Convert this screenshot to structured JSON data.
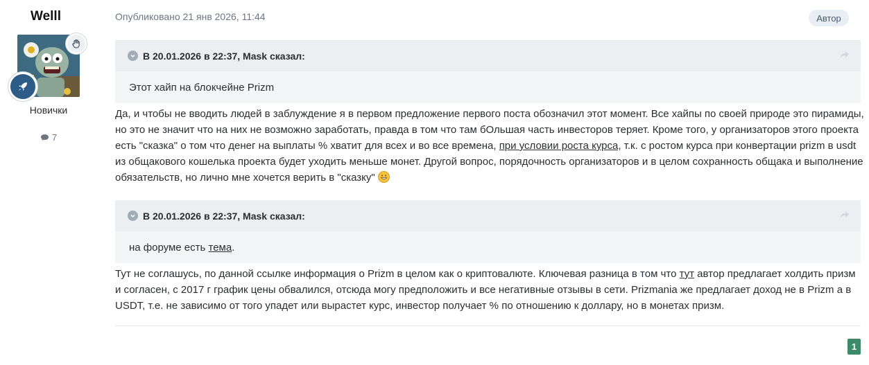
{
  "author": {
    "username": "Welll",
    "rank": "Новички",
    "post_count": "7",
    "avatar_icon": "zombie-cartoon-avatar",
    "badge_icons": [
      "raised-hand-icon",
      "rocket-icon"
    ]
  },
  "post": {
    "published": "Опубликовано 21 янв 2026, 11:44",
    "author_tag": "Автор",
    "quotes": [
      {
        "header": "В 20.01.2026 в 22:37, Mask сказал:",
        "body": "Этот хайп на блокчейне Prizm"
      },
      {
        "header": "В 20.01.2026 в 22:37, Mask сказал:",
        "body_prefix": "на форуме есть ",
        "body_link": "тема",
        "body_suffix": "."
      }
    ],
    "paragraph1": {
      "text_a": "Да, и чтобы не вводить людей в заблуждение я в первом предложение первого поста обозначил этот момент. Все хайпы по своей природе это пирамиды, но это не значит что на них не возможно заработать, правда в том что там бОльшая часть инвесторов теряет. Кроме того, у организаторов этого проекта есть \"сказка\" о том что денег на выплаты % хватит для всех и во все времена, ",
      "link": "при условии роста курса,",
      "text_b": " т.к. с ростом курса при конвертации prizm в usdt из общакового кошелька проекта будет уходить меньше монет. Другой вопрос, порядочность организаторов и в целом сохранность общака и выполнение обязательств, но лично мне хочется верить в \"сказку\" ",
      "emoji": "grinning-face-emoji"
    },
    "paragraph2": {
      "text_a": "Тут не соглашусь, по данной ссылке информация о Prizm в целом как о криптовалюте. Ключевая разница в том что ",
      "link": "тут",
      "text_b": " автор предлагает холдить призм и согласен, с 2017 г график цены обвалился, отсюда могу предположить и все негативные отзывы в сети. Prizmania же предлагает доход не в Prizm а в USDT, т.е. не зависимо от того упадет или вырастет курс, инвестор получает % по отношению к доллару, но в монетах призм."
    }
  },
  "pagination": {
    "current": "1"
  },
  "colors": {
    "page_badge": "#3c8a6a",
    "rocket_badge": "#2d5c86",
    "quote_bg": "#f4f5f7"
  }
}
